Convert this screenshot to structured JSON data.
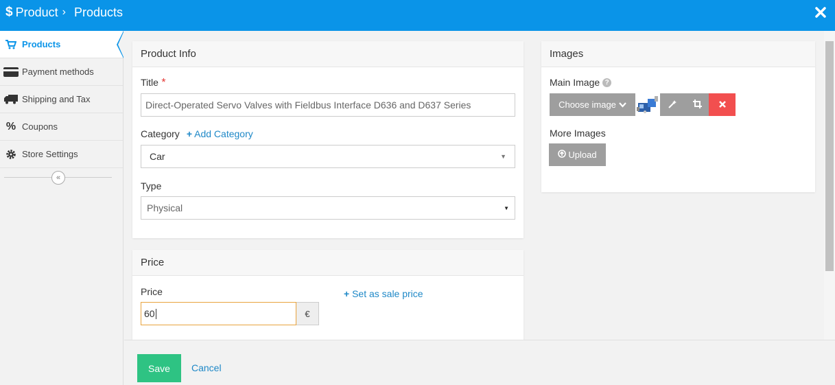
{
  "header": {
    "breadcrumb_root": "Product",
    "breadcrumb_separator": "›",
    "page_title": "Products",
    "accent_color": "#0a94e8"
  },
  "sidebar": {
    "items": [
      {
        "label": "Products",
        "icon": "cart-icon",
        "active": true
      },
      {
        "label": "Payment methods",
        "icon": "credit-card-icon",
        "active": false
      },
      {
        "label": "Shipping and Tax",
        "icon": "truck-icon",
        "active": false
      },
      {
        "label": "Coupons",
        "icon": "percent-icon",
        "active": false
      },
      {
        "label": "Store Settings",
        "icon": "gear-icon",
        "active": false
      }
    ],
    "collapse_icon": "double-chevron-left-icon"
  },
  "product_info": {
    "heading": "Product Info",
    "title_label": "Title",
    "title_required_mark": "*",
    "title_value": "Direct-Operated Servo Valves with Fieldbus Interface D636 and D637 Series",
    "category_label": "Category",
    "add_category_label": "Add Category",
    "category_value": "Car",
    "type_label": "Type",
    "type_value": "Physical"
  },
  "price": {
    "heading": "Price",
    "price_label": "Price",
    "price_value": "60",
    "currency_symbol": "€",
    "sale_price_link": "Set as sale price"
  },
  "images": {
    "heading": "Images",
    "main_image_label": "Main Image",
    "choose_image_label": "Choose image",
    "more_images_label": "More Images",
    "upload_label": "Upload"
  },
  "footer": {
    "save_label": "Save",
    "cancel_label": "Cancel",
    "save_color": "#2ec383"
  }
}
